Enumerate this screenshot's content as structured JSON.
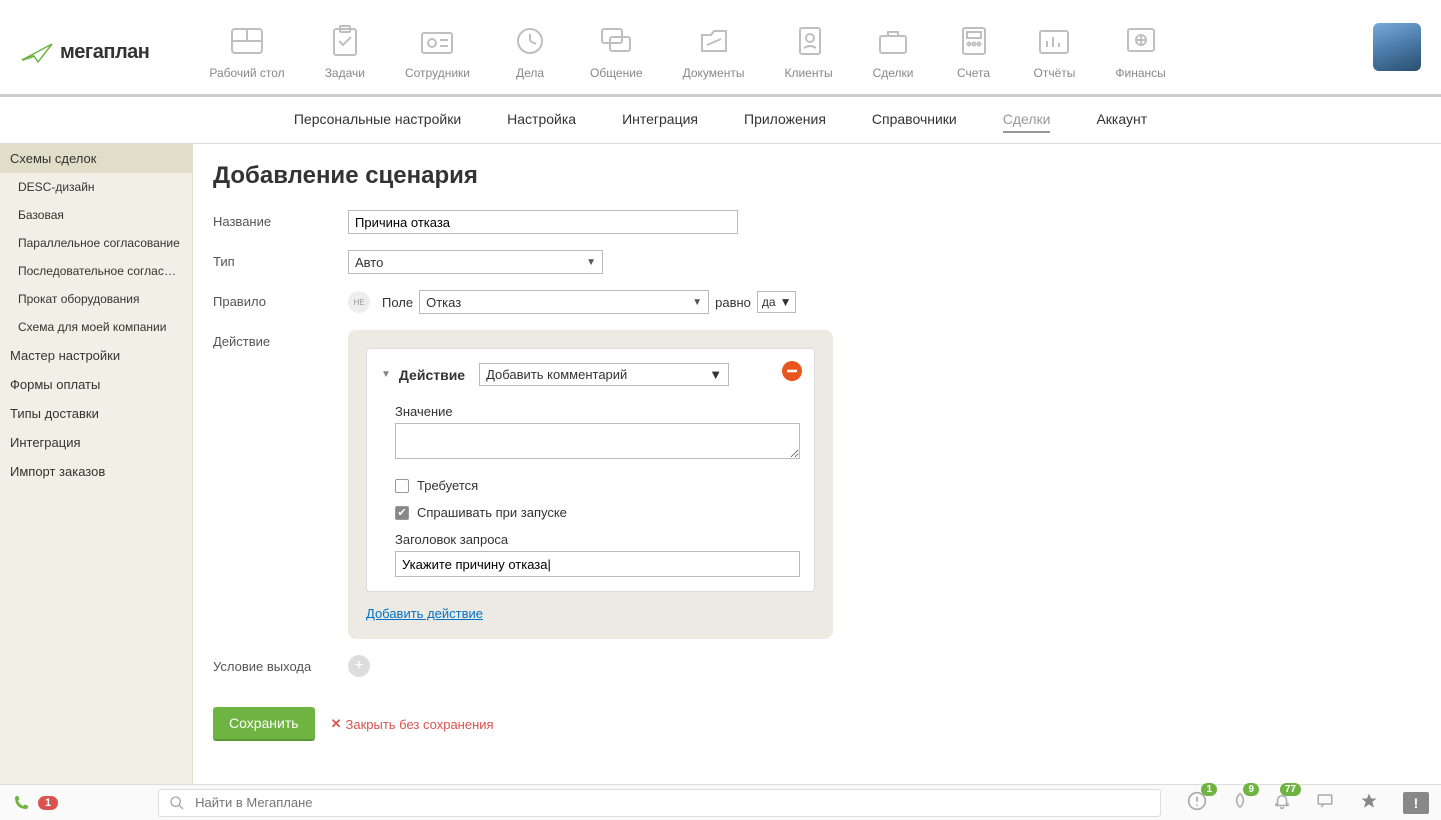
{
  "logo_text": "мегаплан",
  "top_nav": [
    {
      "label": "Рабочий стол"
    },
    {
      "label": "Задачи"
    },
    {
      "label": "Сотрудники"
    },
    {
      "label": "Дела"
    },
    {
      "label": "Общение"
    },
    {
      "label": "Документы"
    },
    {
      "label": "Клиенты"
    },
    {
      "label": "Сделки"
    },
    {
      "label": "Счета"
    },
    {
      "label": "Отчёты"
    },
    {
      "label": "Финансы"
    }
  ],
  "sub_nav": [
    {
      "label": "Персональные настройки"
    },
    {
      "label": "Настройка"
    },
    {
      "label": "Интеграция"
    },
    {
      "label": "Приложения"
    },
    {
      "label": "Справочники"
    },
    {
      "label": "Сделки",
      "active": true
    },
    {
      "label": "Аккаунт"
    }
  ],
  "sidebar": {
    "group_header": "Схемы сделок",
    "sub_items": [
      "DESC-дизайн",
      "Базовая",
      "Параллельное согласование",
      "Последовательное согласов...",
      "Прокат оборудования",
      "Схема для моей компании"
    ],
    "items": [
      "Мастер настройки",
      "Формы оплаты",
      "Типы доставки",
      "Интеграция",
      "Импорт заказов"
    ]
  },
  "page": {
    "title": "Добавление сценария",
    "labels": {
      "name": "Название",
      "type": "Тип",
      "rule": "Правило",
      "action": "Действие",
      "exit": "Условие выхода"
    },
    "name_value": "Причина отказа",
    "type_value": "Авто",
    "rule": {
      "not_label": "НЕ",
      "field_label": "Поле",
      "field_value": "Отказ",
      "op_label": "равно",
      "val": "да"
    },
    "action_card": {
      "header": "Действие",
      "action_select_value": "Добавить комментарий",
      "value_label": "Значение",
      "required_label": "Требуется",
      "required_checked": false,
      "ask_label": "Спрашивать при запуске",
      "ask_checked": true,
      "request_title_label": "Заголовок запроса",
      "request_title_value": "Укажите причину отказа|"
    },
    "add_action_link": "Добавить действие",
    "save_button": "Сохранить",
    "close_link": "Закрыть без сохранения"
  },
  "bottom": {
    "phone_count": "1",
    "search_placeholder": "Найти в Мегаплане",
    "badge_clock": "1",
    "badge_fire": "9",
    "badge_bell": "77"
  }
}
